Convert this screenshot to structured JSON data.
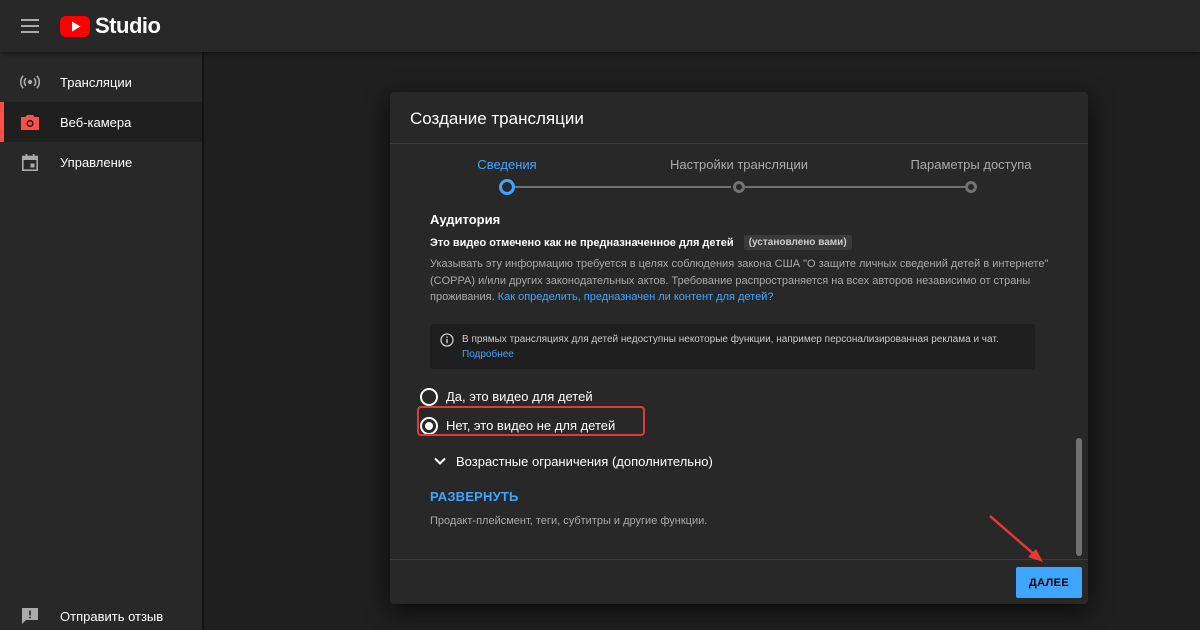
{
  "app": {
    "logo_text": "Studio"
  },
  "sidebar": {
    "items": [
      {
        "label": "Трансляции",
        "icon": "broadcast-icon",
        "active": false
      },
      {
        "label": "Веб-камера",
        "icon": "camera-icon",
        "active": true
      },
      {
        "label": "Управление",
        "icon": "calendar-icon",
        "active": false
      }
    ],
    "feedback_label": "Отправить отзыв"
  },
  "dialog": {
    "title": "Создание трансляции",
    "steps": [
      {
        "label": "Сведения",
        "active": true
      },
      {
        "label": "Настройки трансляции",
        "active": false
      },
      {
        "label": "Параметры доступа",
        "active": false
      }
    ],
    "audience": {
      "title": "Аудитория",
      "status": "Это видео отмечено как не предназначенное для детей",
      "status_chip": "(установлено вами)",
      "description": "Указывать эту информацию требуется в целях соблюдения закона США \"О защите личных сведений детей в интернете\" (COPPA) и/или других законодательных актов. Требование распространяется на всех авторов независимо от страны проживания.",
      "help_link": "Как определить, предназначен ли контент для детей?",
      "info_text": "В прямых трансляциях для детей недоступны некоторые функции, например персонализированная реклама и чат.",
      "info_link": "Подробнее",
      "option_yes": "Да, это видео для детей",
      "option_no": "Нет, это видео не для детей",
      "selected": "no"
    },
    "age_restriction_label": "Возрастные ограничения (дополнительно)",
    "expand_label": "РАЗВЕРНУТЬ",
    "expand_description": "Продакт-плейсмент, теги, субтитры и другие функции.",
    "next_label": "ДАЛЕЕ"
  },
  "colors": {
    "accent": "#3ea6ff",
    "brand_red": "#ff0000",
    "highlight": "#e53935"
  }
}
